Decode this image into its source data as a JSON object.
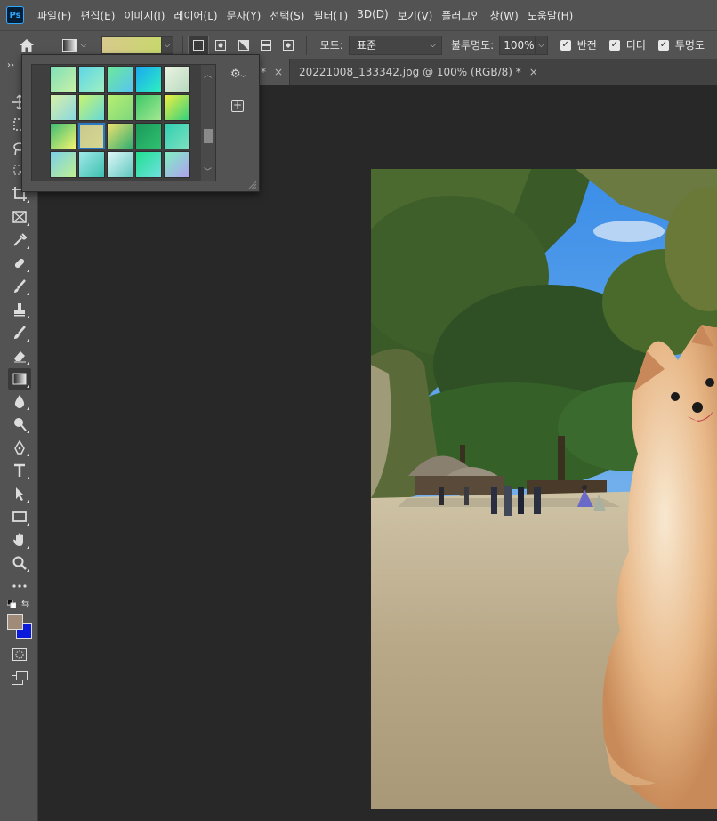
{
  "app": {
    "logo_text": "Ps",
    "menu": [
      "파일(F)",
      "편집(E)",
      "이미지(I)",
      "레이어(L)",
      "문자(Y)",
      "선택(S)",
      "필터(T)",
      "3D(D)",
      "보기(V)",
      "플러그인",
      "창(W)",
      "도움말(H)"
    ]
  },
  "options": {
    "mode_label": "모드:",
    "mode_value": "표준",
    "opacity_label": "불투명도:",
    "opacity_value": "100%",
    "checks": [
      {
        "label": "반전",
        "checked": true
      },
      {
        "label": "디더",
        "checked": true
      },
      {
        "label": "투명도",
        "checked": true
      }
    ]
  },
  "tabs": [
    {
      "label": "*",
      "close": "×"
    },
    {
      "label": "20221008_133342.jpg @ 100% (RGB/8) *",
      "close": "×"
    }
  ],
  "toolbar": {
    "collapse": "››",
    "tools": [
      "move-tool",
      "marquee-tool",
      "lasso-tool",
      "object-select-tool",
      "crop-tool",
      "frame-tool",
      "eyedropper-tool",
      "healing-brush-tool",
      "brush-tool",
      "clone-stamp-tool",
      "history-brush-tool",
      "eraser-tool",
      "gradient-tool",
      "blur-tool",
      "dodge-tool",
      "pen-tool",
      "type-tool",
      "path-select-tool",
      "rectangle-tool",
      "hand-tool",
      "zoom-tool",
      "more-tools"
    ],
    "active_tool": "gradient-tool",
    "foreground_color": "#a08a78",
    "background_color": "#0a1adc"
  },
  "gradient_picker": {
    "gear_icon": "⚙",
    "new_icon": "+",
    "selected_index": 11,
    "swatches": [
      [
        "#7ee0b8",
        "#c9f0a8"
      ],
      [
        "#5fd6e8",
        "#9ef0c0"
      ],
      [
        "#6ee89a",
        "#56c6f0"
      ],
      [
        "#1aa8f0",
        "#2ef0c0"
      ],
      [
        "#eaf4e0",
        "#b8d8c0"
      ],
      [
        "#d8f0a8",
        "#8ad8e0"
      ],
      [
        "#c8f470",
        "#66d8d8"
      ],
      [
        "#b8ee70",
        "#7ed87e"
      ],
      [
        "#3ec86a",
        "#a4e890"
      ],
      [
        "#f0f040",
        "#30d080"
      ],
      [
        "#3ebd74",
        "#f4f470"
      ],
      [
        "#c8c890",
        "#d8d890"
      ],
      [
        "#f0e070",
        "#30b070"
      ],
      [
        "#1a9a5a",
        "#30c070"
      ],
      [
        "#2ed0b0",
        "#7ee0c0"
      ],
      [
        "#7ad0e8",
        "#c0f090"
      ],
      [
        "#a0e8e8",
        "#3ec0b0"
      ],
      [
        "#e0f8f8",
        "#60c8c0"
      ],
      [
        "#20e090",
        "#70e0e0"
      ],
      [
        "#7ef0c0",
        "#b0a0f0"
      ]
    ]
  },
  "colors": {
    "accent": "#31a8ff",
    "panel": "#535353",
    "canvas_bg": "#282828"
  }
}
